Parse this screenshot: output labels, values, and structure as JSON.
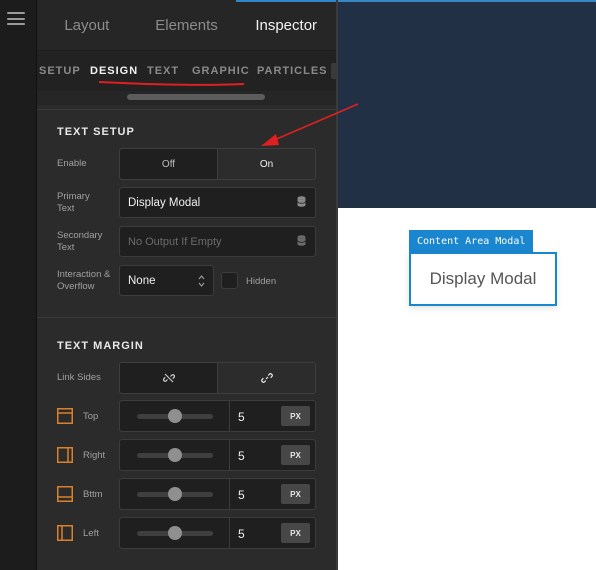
{
  "main_tabs": [
    {
      "label": "Layout",
      "active": false
    },
    {
      "label": "Elements",
      "active": false
    },
    {
      "label": "Inspector",
      "active": true
    }
  ],
  "sub_tabs": [
    {
      "label": "SETUP",
      "active": false
    },
    {
      "label": "DESIGN",
      "active": true
    },
    {
      "label": "TEXT",
      "active": false
    },
    {
      "label": "GRAPHIC",
      "active": false
    },
    {
      "label": "PARTICLES",
      "active": false
    }
  ],
  "text_setup": {
    "title": "TEXT SETUP",
    "enable": {
      "label": "Enable",
      "options": [
        "Off",
        "On"
      ],
      "selected": "On"
    },
    "primary_text": {
      "label": "Primary Text",
      "value": "Display Modal",
      "icon": "database-icon"
    },
    "secondary_text": {
      "label": "Secondary Text",
      "placeholder": "No Output If Empty",
      "icon": "database-icon"
    },
    "interaction": {
      "label": "Interaction & Overflow",
      "value": "None",
      "hidden_label": "Hidden",
      "hidden_checked": false
    }
  },
  "text_margin": {
    "title": "TEXT MARGIN",
    "link_sides": {
      "label": "Link Sides",
      "options": [
        "unlink-icon",
        "link-icon"
      ],
      "selected": "link-icon"
    },
    "rows": [
      {
        "label": "Top",
        "value": "5",
        "unit": "PX",
        "level": 0.5
      },
      {
        "label": "Right",
        "value": "5",
        "unit": "PX",
        "level": 0.5
      },
      {
        "label": "Bttm",
        "value": "5",
        "unit": "PX",
        "level": 0.5
      },
      {
        "label": "Left",
        "value": "5",
        "unit": "PX",
        "level": 0.5
      }
    ]
  },
  "canvas": {
    "element_tag": "Content Area Modal",
    "element_text": "Display Modal",
    "colors": {
      "header": "#213045",
      "accent": "#1a86d0"
    }
  },
  "annotations": {
    "underline_color": "#e02020",
    "arrow_color": "#e02020"
  }
}
